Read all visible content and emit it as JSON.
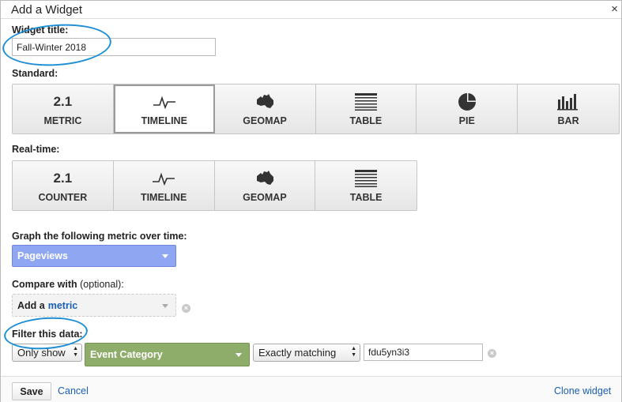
{
  "dialog": {
    "title": "Add a Widget",
    "close": "×"
  },
  "widget_title": {
    "label": "Widget title:",
    "value": "Fall-Winter 2018"
  },
  "standard": {
    "label": "Standard:",
    "tiles": [
      {
        "icon": "2.1",
        "label": "METRIC"
      },
      {
        "icon": "timeline-icon",
        "label": "TIMELINE"
      },
      {
        "icon": "geomap-icon",
        "label": "GEOMAP"
      },
      {
        "icon": "table-icon",
        "label": "TABLE"
      },
      {
        "icon": "pie-icon",
        "label": "PIE"
      },
      {
        "icon": "bar-icon",
        "label": "BAR"
      }
    ],
    "selected": "TIMELINE"
  },
  "realtime": {
    "label": "Real-time:",
    "tiles": [
      {
        "icon": "2.1",
        "label": "COUNTER"
      },
      {
        "icon": "timeline-icon",
        "label": "TIMELINE"
      },
      {
        "icon": "geomap-icon",
        "label": "GEOMAP"
      },
      {
        "icon": "table-icon",
        "label": "TABLE"
      }
    ]
  },
  "graph": {
    "label": "Graph the following metric over time:",
    "metric": "Pageviews"
  },
  "compare": {
    "label": "Compare with",
    "optional": "(optional):",
    "add": "Add a",
    "metric_link": "metric"
  },
  "filter": {
    "label": "Filter this data:",
    "show": "Only show",
    "dimension": "Event Category",
    "match": "Exactly matching",
    "value": "fdu5yn3i3"
  },
  "footer": {
    "save": "Save",
    "cancel": "Cancel",
    "clone": "Clone widget"
  },
  "colors": {
    "annotation": "#1e8fd4",
    "metric_dropdown": "#8fa6f2",
    "dimension_dropdown": "#8fad6a",
    "link": "#1a5fb4"
  }
}
